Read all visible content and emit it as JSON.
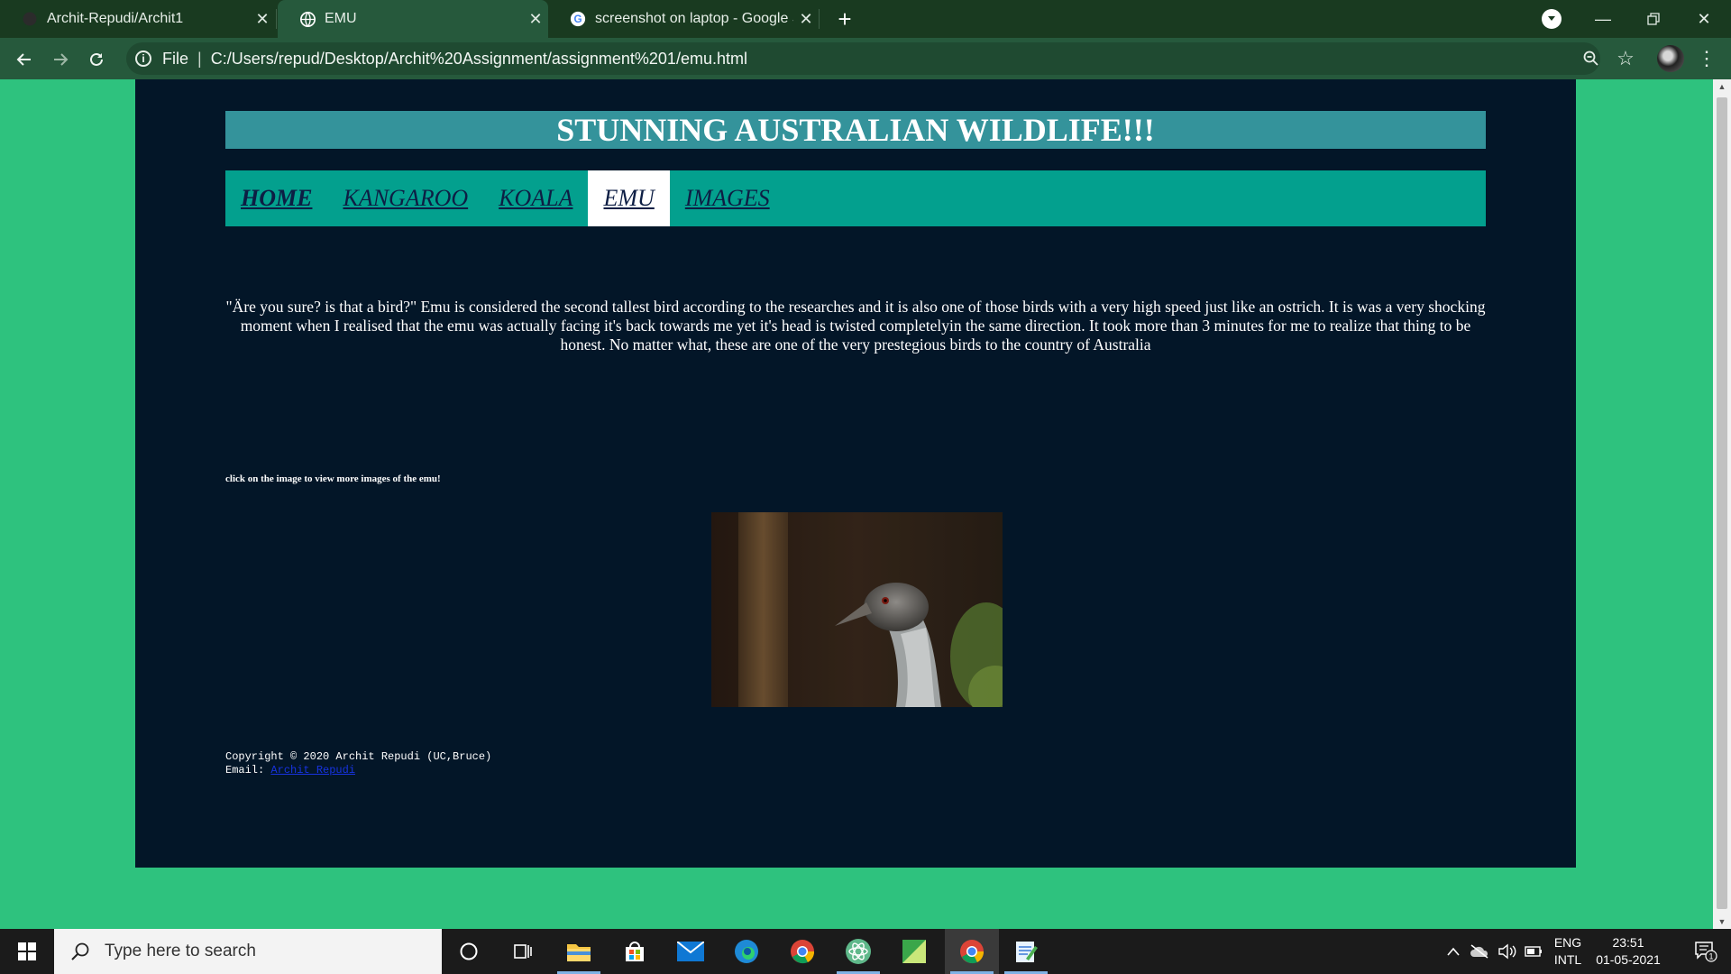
{
  "browser": {
    "tabs": [
      {
        "title": "Archit-Repudi/Archit1",
        "icon": "github-icon"
      },
      {
        "title": "EMU",
        "icon": "globe-icon"
      },
      {
        "title": "screenshot on laptop - Google Se",
        "icon": "google-icon"
      }
    ],
    "new_tab": "+",
    "address": {
      "scheme_label": "File",
      "url": "C:/Users/repud/Desktop/Archit%20Assignment/assignment%201/emu.html"
    }
  },
  "page": {
    "banner": "STUNNING AUSTRALIAN WILDLIFE!!!",
    "nav": [
      {
        "label": "HOME"
      },
      {
        "label": "KANGAROO"
      },
      {
        "label": "KOALA"
      },
      {
        "label": "EMU"
      },
      {
        "label": "IMAGES"
      }
    ],
    "paragraph": "\"Äre you sure? is that a bird?\" Emu is considered the second tallest bird according to the researches and it is also one of those birds with a very high speed just like an ostrich. It is was a very shocking moment when I realised that the emu was actually facing it's back towards me yet it's head is twisted completelyin the same direction. It took more than 3 minutes for me to realize that thing to be honest. No matter what, these are one of the very prestegious birds to the country of Australia",
    "image_hint": "click on the image to view more images of the emu!",
    "footer": {
      "copyright": "Copyright © 2020 Archit Repudi (UC,Bruce)",
      "email_label": "Email: ",
      "email_link": "Archit Repudi"
    },
    "colors": {
      "page_bg": "#2ec27e",
      "container_bg": "#031628",
      "banner_bg": "#34939b",
      "nav_bg": "#03a08e"
    }
  },
  "taskbar": {
    "search_placeholder": "Type here to search",
    "lang_top": "ENG",
    "lang_bottom": "INTL",
    "time": "23:51",
    "date": "01-05-2021",
    "notification_count": "1"
  }
}
